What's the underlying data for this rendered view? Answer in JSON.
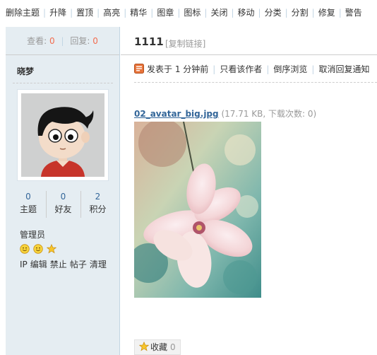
{
  "toolbar": {
    "items": [
      "删除主题",
      "升降",
      "置顶",
      "高亮",
      "精华",
      "图章",
      "图标",
      "关闭",
      "移动",
      "分类",
      "分割",
      "修复",
      "警告"
    ]
  },
  "sidebar": {
    "stats": {
      "view_label": "查看:",
      "view_count": "0",
      "reply_label": "回复:",
      "reply_count": "0"
    },
    "username": "晓梦",
    "counts": [
      {
        "value": "0",
        "label": "主题"
      },
      {
        "value": "0",
        "label": "好友"
      },
      {
        "value": "2",
        "label": "积分"
      }
    ],
    "group": "管理员",
    "admin_links": [
      "IP",
      "编辑",
      "禁止",
      "帖子",
      "清理"
    ]
  },
  "post": {
    "title": "1111",
    "copy_link": "[复制链接]",
    "meta": {
      "posted": "发表于 1 分钟前",
      "author_only": "只看该作者",
      "reverse": "倒序浏览",
      "cancel_notify": "取消回复通知"
    },
    "attachment": {
      "name": "02_avatar_big.jpg",
      "info": "(17.71 KB, 下载次数: 0)"
    },
    "favorite": {
      "label": "收藏",
      "count": "0"
    }
  },
  "colors": {
    "sidebar_bg": "#e5edf2",
    "link": "#336699",
    "count_accent": "#f26c4f",
    "divider": "#c2d5e3"
  }
}
